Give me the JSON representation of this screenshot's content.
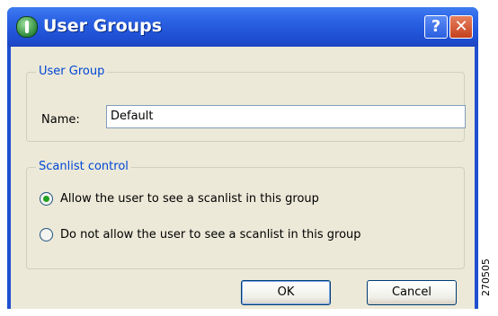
{
  "window": {
    "title": "User Groups",
    "help_label": "?",
    "close_label": "✕"
  },
  "user_group": {
    "legend": "User Group",
    "name_label": "Name:",
    "name_value": "Default"
  },
  "scanlist": {
    "legend": "Scanlist control",
    "options": [
      {
        "label": "Allow the user to see a scanlist in this group",
        "checked": true
      },
      {
        "label": "Do not allow the user to see a scanlist in this group",
        "checked": false
      }
    ]
  },
  "buttons": {
    "ok": "OK",
    "cancel": "Cancel"
  },
  "figure_ref": "270505",
  "icons": {
    "app": "globe-icon",
    "help": "help-icon",
    "close": "close-icon"
  }
}
